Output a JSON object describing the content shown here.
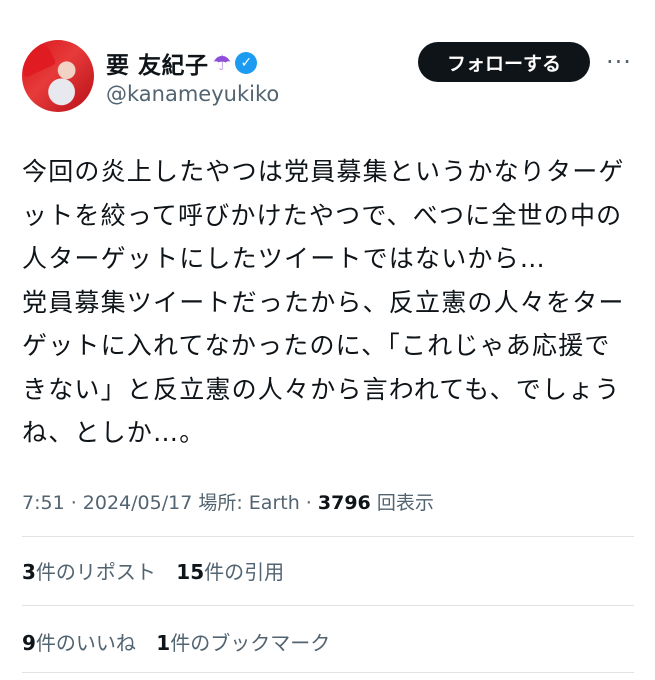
{
  "user": {
    "display_name": "要 友紀子",
    "emoji": "☂",
    "verified_mark": "✓",
    "handle": "@kanameyukiko"
  },
  "actions": {
    "follow_label": "フォローする",
    "more_label": "···"
  },
  "tweet": {
    "lines": [
      "今回の炎上したやつは党員募集というかなりターゲ",
      "ットを絞って呼びかけたやつで、べつに全世の中の",
      "人ターゲットにしたツイートではないから…",
      "党員募集ツイートだったから、反立憲の人々をター",
      "ゲットに入れてなかったのに、「これじゃあ応援で",
      "きない」と反立憲の人々から言われても、でしょう",
      "ね、としか…。"
    ]
  },
  "meta": {
    "time": "7:51",
    "date": "2024/05/17",
    "location": "場所: Earth",
    "views_count": "3796",
    "views_label": "回表示",
    "sep": " · "
  },
  "stats": {
    "reposts_count": "3",
    "reposts_label": "件のリポスト",
    "quotes_count": "15",
    "quotes_label": "件の引用",
    "likes_count": "9",
    "likes_label": "件のいいね",
    "bookmarks_count": "1",
    "bookmarks_label": "件のブックマーク"
  },
  "icons": {
    "avatar": "avatar-photo",
    "verified": "verified-badge-icon",
    "more": "more-options-icon"
  },
  "colors": {
    "follow_bg": "#0f1419",
    "verified": "#1d9bf0",
    "secondary_text": "#536471"
  }
}
